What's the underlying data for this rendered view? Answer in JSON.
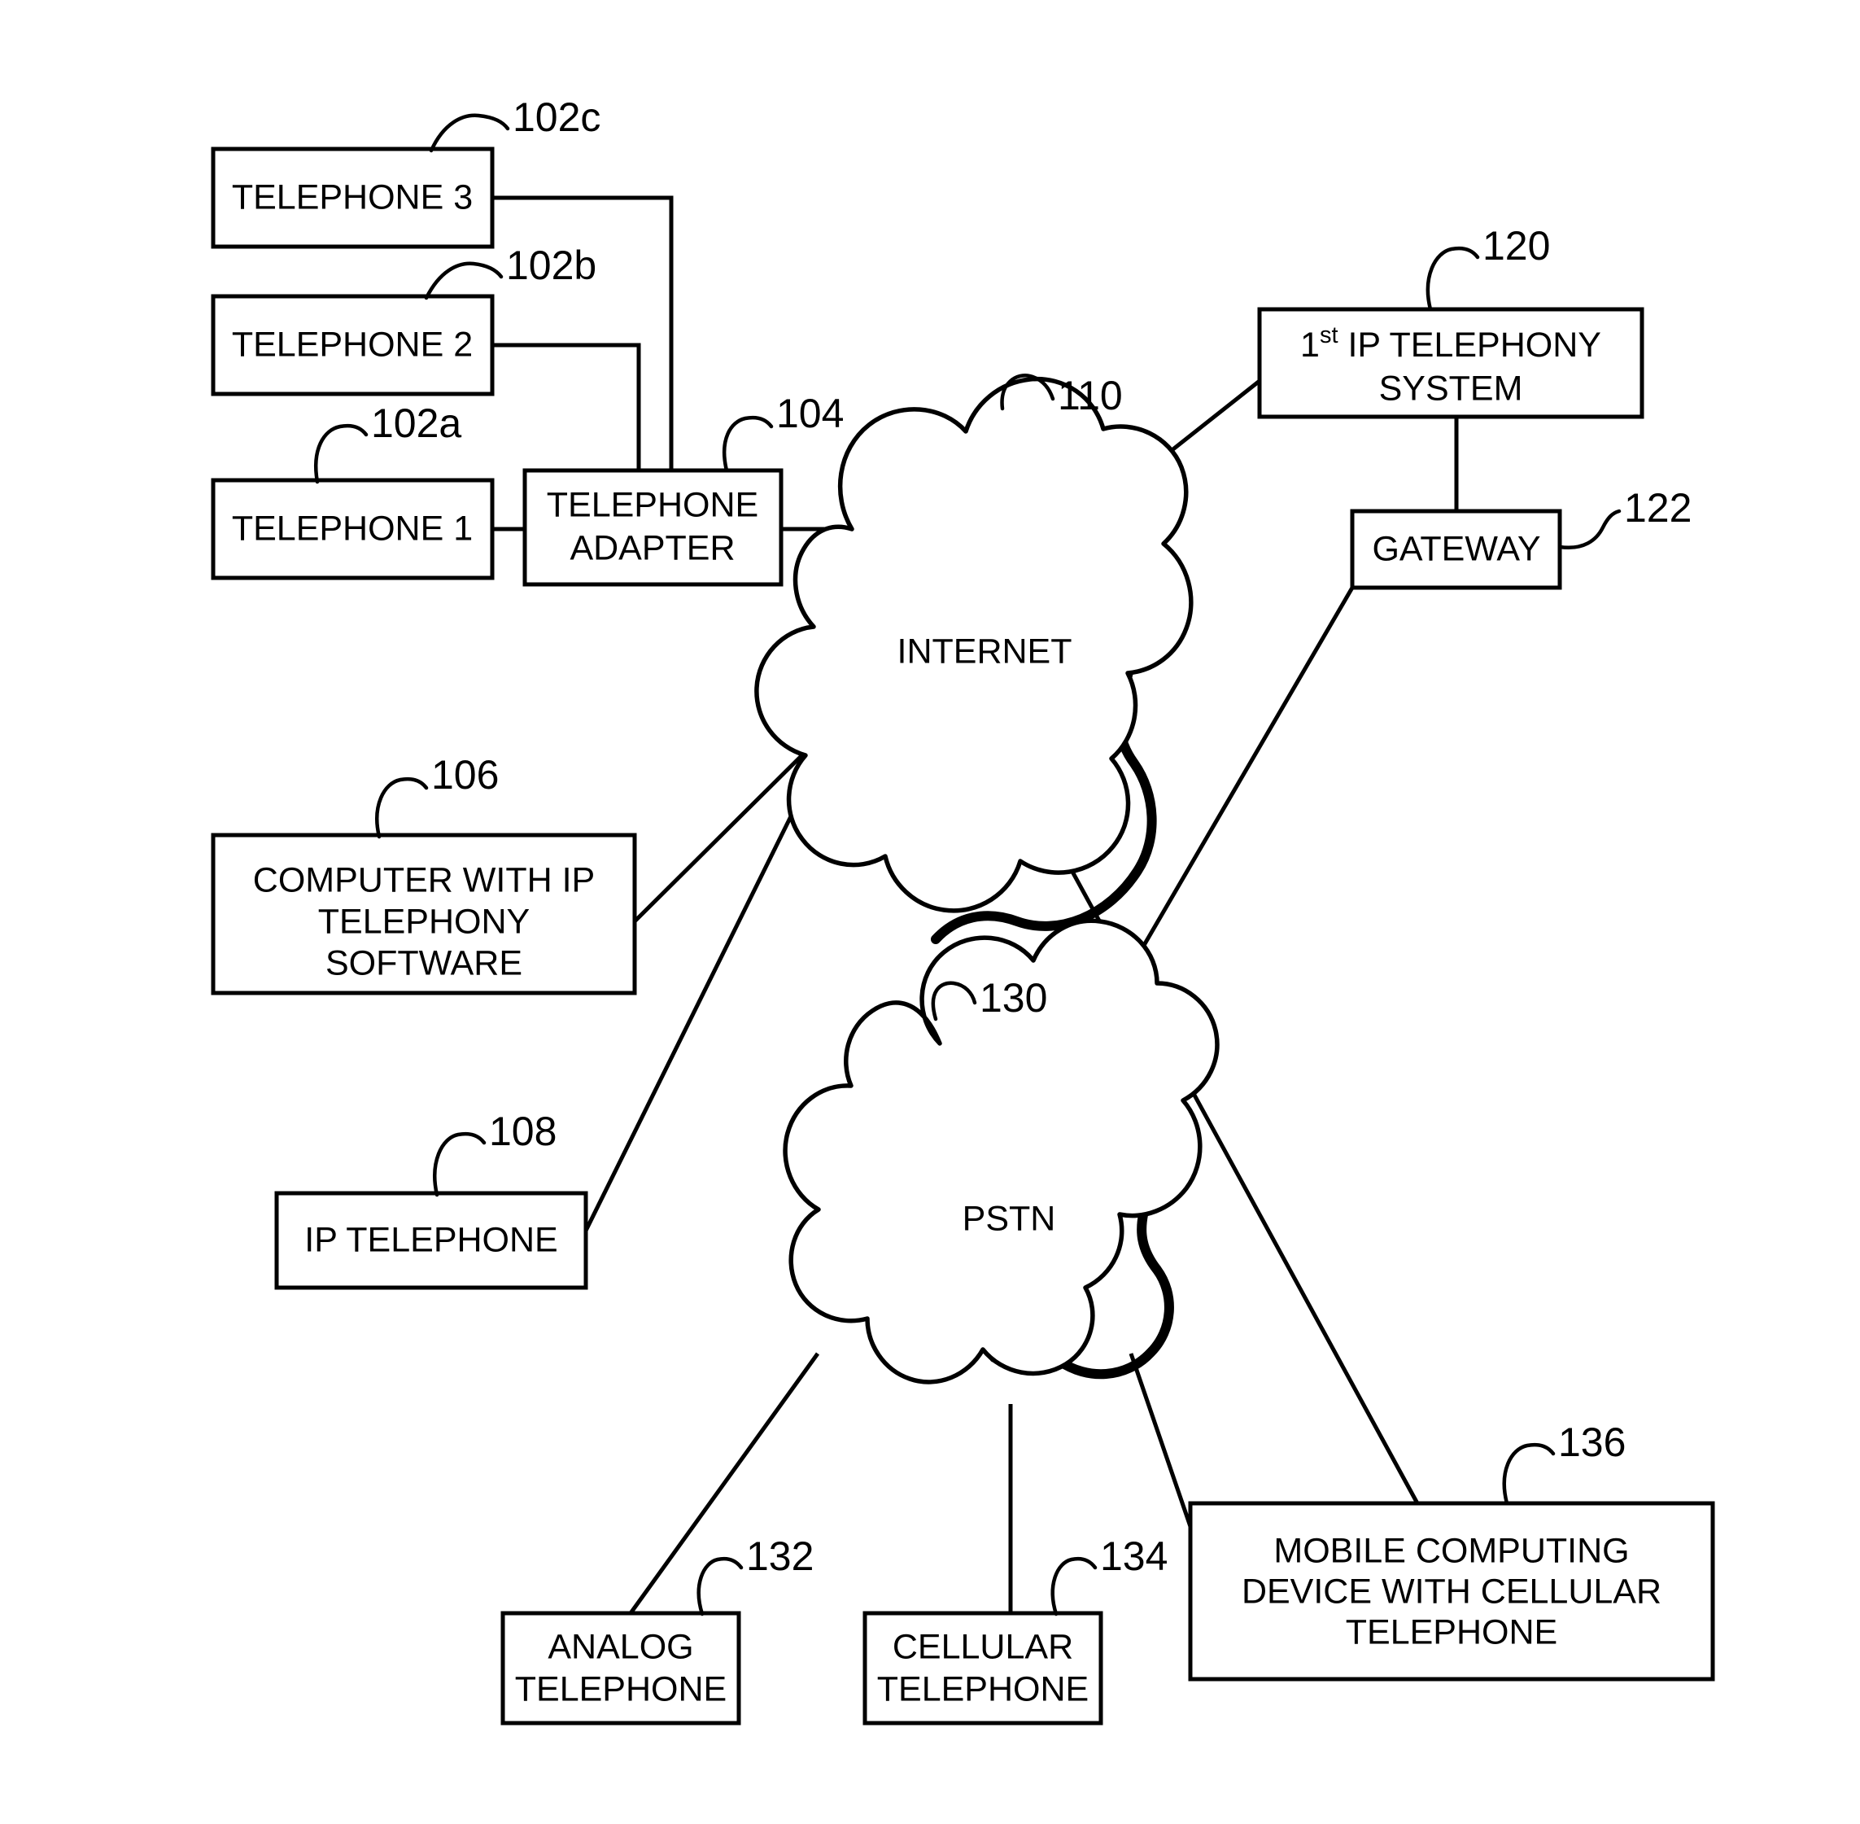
{
  "figure": {
    "type": "patent-network-diagram",
    "background_color": "#ffffff",
    "line_color": "#000000"
  },
  "nodes": {
    "telephone3": {
      "label": "TELEPHONE 3",
      "ref": "102c"
    },
    "telephone2": {
      "label": "TELEPHONE 2",
      "ref": "102b"
    },
    "telephone1": {
      "label": "TELEPHONE 1",
      "ref": "102a"
    },
    "telephone_adapter": {
      "label_line1": "TELEPHONE",
      "label_line2": "ADAPTER",
      "ref": "104"
    },
    "internet": {
      "label": "INTERNET",
      "ref": "110"
    },
    "ip_telephony_system": {
      "label_prefix": "1",
      "label_sup": "st",
      "label_line1_rest": " IP TELEPHONY",
      "label_line2": "SYSTEM",
      "ref": "120"
    },
    "gateway": {
      "label": "GATEWAY",
      "ref": "122"
    },
    "computer": {
      "label_line1": "COMPUTER WITH IP",
      "label_line2": "TELEPHONY",
      "label_line3": "SOFTWARE",
      "ref": "106"
    },
    "ip_telephone": {
      "label": "IP TELEPHONE",
      "ref": "108"
    },
    "pstn": {
      "label": "PSTN",
      "ref": "130"
    },
    "analog_telephone": {
      "label_line1": "ANALOG",
      "label_line2": "TELEPHONE",
      "ref": "132"
    },
    "cellular_telephone": {
      "label_line1": "CELLULAR",
      "label_line2": "TELEPHONE",
      "ref": "134"
    },
    "mobile_device": {
      "label_line1": "MOBILE COMPUTING",
      "label_line2": "DEVICE WITH CELLULAR",
      "label_line3": "TELEPHONE",
      "ref": "136"
    }
  },
  "connections": [
    {
      "from": "telephone1",
      "to": "telephone_adapter"
    },
    {
      "from": "telephone2",
      "to": "telephone_adapter"
    },
    {
      "from": "telephone3",
      "to": "telephone_adapter"
    },
    {
      "from": "telephone_adapter",
      "to": "internet"
    },
    {
      "from": "internet",
      "to": "ip_telephony_system"
    },
    {
      "from": "ip_telephony_system",
      "to": "gateway"
    },
    {
      "from": "gateway",
      "to": "pstn"
    },
    {
      "from": "computer",
      "to": "internet"
    },
    {
      "from": "ip_telephone",
      "to": "internet"
    },
    {
      "from": "internet",
      "to": "mobile_device"
    },
    {
      "from": "pstn",
      "to": "analog_telephone"
    },
    {
      "from": "pstn",
      "to": "cellular_telephone"
    },
    {
      "from": "pstn",
      "to": "mobile_device"
    }
  ]
}
